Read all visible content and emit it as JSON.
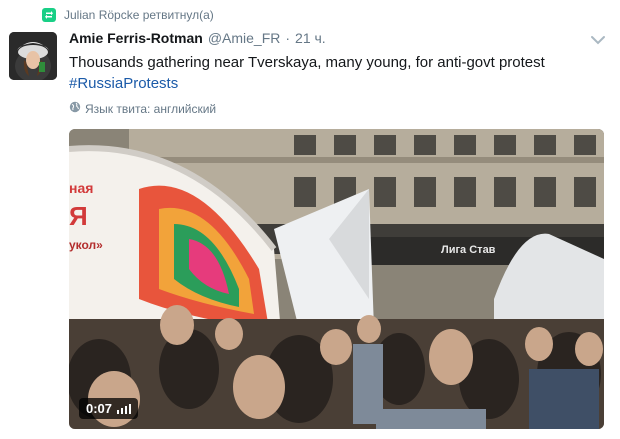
{
  "retweet": {
    "text": "Julian Röpcke ретвитнул(а)",
    "icon": "retweet-icon",
    "icon_color": "#19cf86"
  },
  "tweet": {
    "author_name": "Amie Ferris-Rotman",
    "author_handle": "@Amie_FR",
    "separator": "·",
    "timestamp": "21 ч.",
    "text_line1": "Thousands gathering near Tverskaya, many young, for anti-govt protest",
    "hashtag": "#RussiaProtests",
    "language_note": "Язык твита: английский",
    "menu_icon": "chevron-down-icon"
  },
  "video": {
    "duration": "0:07",
    "sign_text_1": "ная",
    "sign_text_2": "Я",
    "sign_text_3": "укол»",
    "store_sign": "Лига Став"
  },
  "colors": {
    "link": "#1b5aa8",
    "muted": "#657786",
    "text": "#14171a"
  }
}
